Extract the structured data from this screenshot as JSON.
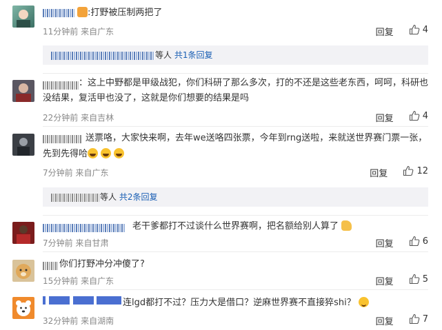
{
  "comments": [
    {
      "text": ":打野被压制两把了",
      "time": "11分钟前",
      "location": "来自广东",
      "reply_label": "回复",
      "likes": "4",
      "replies_summary": {
        "people_suffix": "等人",
        "link": "共1条回复"
      }
    },
    {
      "text": "这上中野都是甲级战犯，你们科研了那么多次，打的不还是这些老东西，呵呵，科研也没结果，复活甲也没了，这就是你们想要的结果是吗",
      "text_line1": "：这上中野都是甲级战犯，你们科研了那么多次，打的不还是这些老东西，呵呵，科研也",
      "text_line2": "没结果，复活甲也没了，这就是你们想要的结果是吗",
      "time": "22分钟前",
      "location": "来自吉林",
      "reply_label": "回复",
      "likes": "4"
    },
    {
      "text_line1": "送票咯，大家快来啊，去年we送咯四张票，今年到rng送啦，来就送世界赛门票一张，",
      "text_line2": "先到先得哈",
      "time": "7分钟前",
      "location": "来自广东",
      "reply_label": "回复",
      "likes": "12",
      "replies_summary": {
        "people_suffix": "等人",
        "link": "共2条回复"
      }
    },
    {
      "text": "老干爹都打不过谈什么世界赛啊，把名额给别人算了",
      "time": "7分钟前",
      "location": "来自甘肃",
      "reply_label": "回复",
      "likes": "6"
    },
    {
      "text": "你们打野冲分冲傻了?",
      "time": "15分钟前",
      "location": "来自广东",
      "reply_label": "回复",
      "likes": "5"
    },
    {
      "text": "连lgd都打不过？压力大是借口？逆麻世界赛不直接猝shi？",
      "time": "32分钟前",
      "location": "来自湖南",
      "reply_label": "回复",
      "likes": "7"
    }
  ],
  "colors": {
    "link": "#1a5fb4",
    "meta": "#888888",
    "reply_bg": "#f2f2f5"
  },
  "icons": {
    "like": "thumbs-up-icon"
  }
}
